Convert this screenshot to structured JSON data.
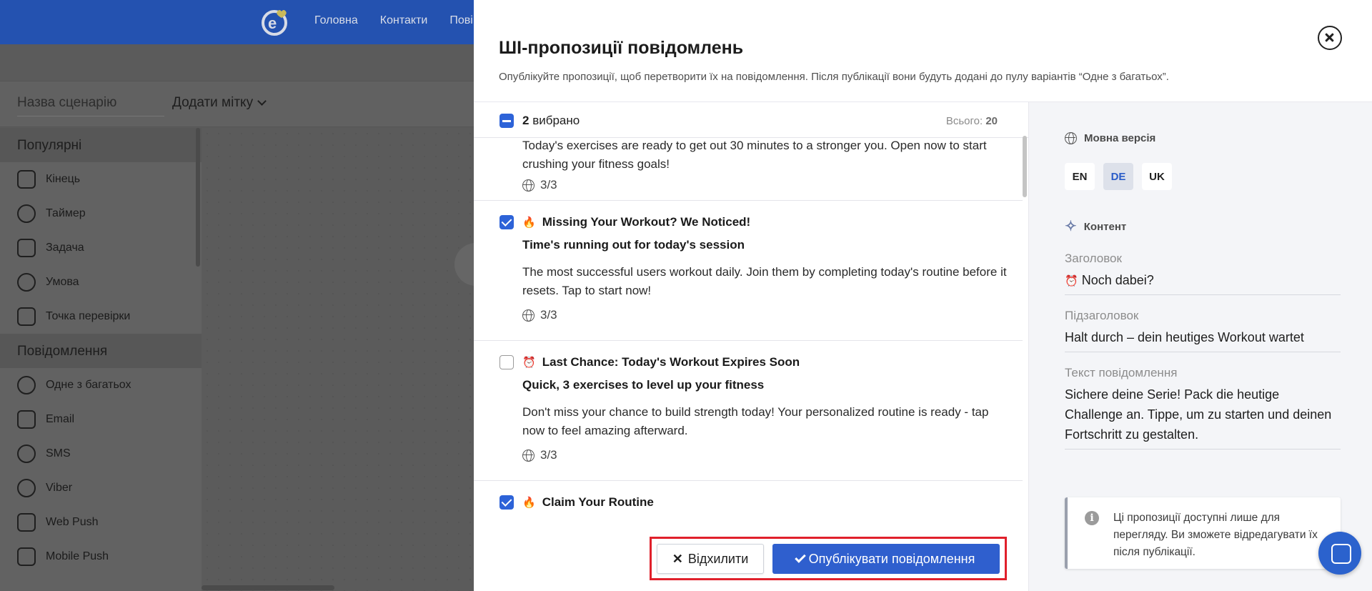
{
  "background": {
    "nav": [
      "Головна",
      "Контакти",
      "Пові"
    ],
    "scenario_placeholder": "Назва сценарію",
    "add_tag": "Додати мітку",
    "sidebar": {
      "section_popular": "Популярні",
      "popular_items": [
        {
          "label": "Кінець",
          "icon": "end-icon"
        },
        {
          "label": "Таймер",
          "icon": "timer-icon"
        },
        {
          "label": "Задача",
          "icon": "task-icon"
        },
        {
          "label": "Умова",
          "icon": "condition-icon"
        },
        {
          "label": "Точка перевірки",
          "icon": "checkpoint-icon"
        }
      ],
      "section_messages": "Повідомлення",
      "message_items": [
        {
          "label": "Одне з багатьох",
          "icon": "one-of-many-icon"
        },
        {
          "label": "Email",
          "icon": "email-icon"
        },
        {
          "label": "SMS",
          "icon": "sms-icon"
        },
        {
          "label": "Viber",
          "icon": "viber-icon"
        },
        {
          "label": "Web Push",
          "icon": "web-push-icon"
        },
        {
          "label": "Mobile Push",
          "icon": "mobile-push-icon"
        }
      ]
    }
  },
  "drawer": {
    "title": "ШІ-пропозиції повідомлень",
    "subtitle": "Опублікуйте пропозиції, щоб перетворити їх на повідомлення. Після публікації вони будуть додані до пулу варіантів “Одне з багатьох”.",
    "selection": {
      "count": "2",
      "label": "вибрано",
      "total_label": "Всього:",
      "total_value": "20"
    },
    "cards": [
      {
        "checked": true,
        "emoji": "",
        "title": "",
        "subtitle": "",
        "body": "Today's exercises are ready to get out 30 minutes to a stronger you. Open now to start crushing your fitness goals!",
        "langs": "3/3"
      },
      {
        "checked": true,
        "emoji": "🔥",
        "title": "Missing Your Workout? We Noticed!",
        "subtitle": "Time's running out for today's session",
        "body": "The most successful users workout daily. Join them by completing today's routine before it resets. Tap to start now!",
        "langs": "3/3"
      },
      {
        "checked": false,
        "emoji": "⏰",
        "title": "Last Chance: Today's Workout Expires Soon",
        "subtitle": "Quick, 3 exercises to level up your fitness",
        "body": "Don't miss your chance to build strength today! Your personalized routine is ready - tap now to feel amazing afterward.",
        "langs": "3/3"
      },
      {
        "checked": true,
        "emoji": "🔥",
        "title": "Claim Your Routine",
        "subtitle": "",
        "body": "",
        "langs": ""
      }
    ],
    "buttons": {
      "reject": "Відхилити",
      "publish": "Опублікувати повідомлення"
    },
    "panel": {
      "lang_label": "Мовна версія",
      "langs": [
        "EN",
        "DE",
        "UK"
      ],
      "active_lang": "DE",
      "content_label": "Контент",
      "heading_label": "Заголовок",
      "heading_emoji": "⏰",
      "heading_value": "Noch dabei?",
      "subheading_label": "Підзаголовок",
      "subheading_value": "Halt durch – dein heutiges Workout wartet",
      "text_label": "Текст повідомлення",
      "text_value": "Sichere deine Serie! Pack die heutige Challenge an. Tippe, um zu starten und deinen Fortschritt zu gestalten.",
      "info": "Ці пропозиції доступні лише для перегляду. Ви зможете відредагувати їх після публікації."
    }
  },
  "colors": {
    "accent": "#2f5fce",
    "topbar": "#2452b0",
    "highlight": "#e0202b"
  }
}
